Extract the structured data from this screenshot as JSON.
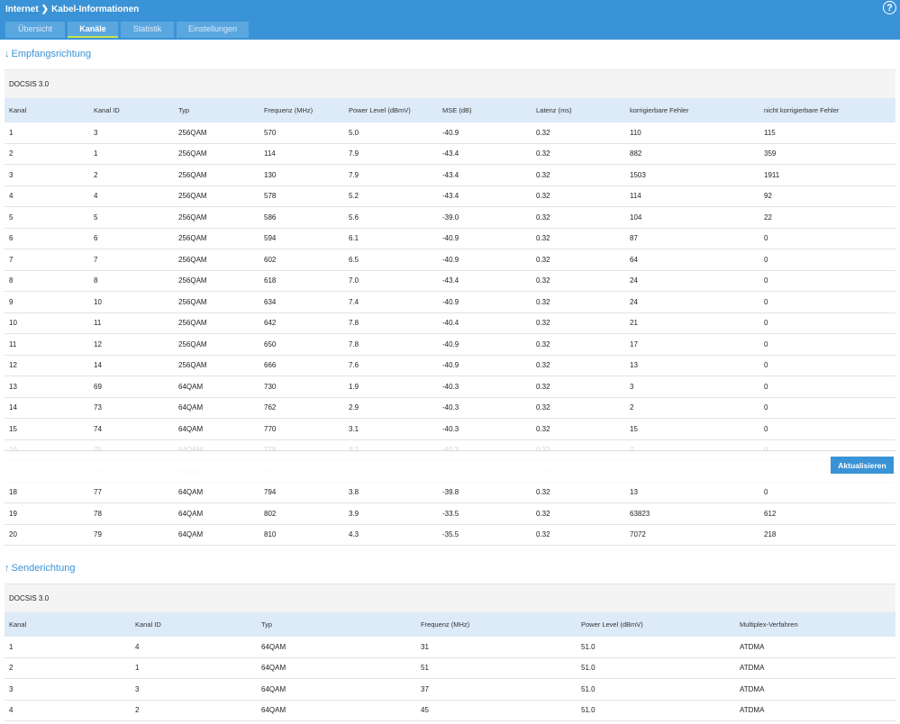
{
  "header": {
    "breadcrumb": [
      "Internet",
      "Kabel-Informationen"
    ],
    "help_glyph": "?"
  },
  "tabs": [
    {
      "label": "Übersicht",
      "active": false
    },
    {
      "label": "Kanäle",
      "active": true
    },
    {
      "label": "Statistik",
      "active": false
    },
    {
      "label": "Einstellungen",
      "active": false
    }
  ],
  "downstream": {
    "title": "Empfangsrichtung",
    "docsis": "DOCSIS 3.0",
    "columns": [
      "Kanal",
      "Kanal ID",
      "Typ",
      "Frequenz (MHz)",
      "Power Level (dBmV)",
      "MSE (dB)",
      "Latenz (ms)",
      "korrigierbare Fehler",
      "nicht korrigierbare Fehler"
    ],
    "rows": [
      [
        "1",
        "3",
        "256QAM",
        "570",
        "5.0",
        "-40.9",
        "0.32",
        "110",
        "115"
      ],
      [
        "2",
        "1",
        "256QAM",
        "114",
        "7.9",
        "-43.4",
        "0.32",
        "882",
        "359"
      ],
      [
        "3",
        "2",
        "256QAM",
        "130",
        "7.9",
        "-43.4",
        "0.32",
        "1503",
        "1911"
      ],
      [
        "4",
        "4",
        "256QAM",
        "578",
        "5.2",
        "-43.4",
        "0.32",
        "114",
        "92"
      ],
      [
        "5",
        "5",
        "256QAM",
        "586",
        "5.6",
        "-39.0",
        "0.32",
        "104",
        "22"
      ],
      [
        "6",
        "6",
        "256QAM",
        "594",
        "6.1",
        "-40.9",
        "0.32",
        "87",
        "0"
      ],
      [
        "7",
        "7",
        "256QAM",
        "602",
        "6.5",
        "-40.9",
        "0.32",
        "64",
        "0"
      ],
      [
        "8",
        "8",
        "256QAM",
        "618",
        "7.0",
        "-43.4",
        "0.32",
        "24",
        "0"
      ],
      [
        "9",
        "10",
        "256QAM",
        "634",
        "7.4",
        "-40.9",
        "0.32",
        "24",
        "0"
      ],
      [
        "10",
        "11",
        "256QAM",
        "642",
        "7.8",
        "-40.4",
        "0.32",
        "21",
        "0"
      ],
      [
        "11",
        "12",
        "256QAM",
        "650",
        "7.8",
        "-40.9",
        "0.32",
        "17",
        "0"
      ],
      [
        "12",
        "14",
        "256QAM",
        "666",
        "7.6",
        "-40.9",
        "0.32",
        "13",
        "0"
      ],
      [
        "13",
        "69",
        "64QAM",
        "730",
        "1.9",
        "-40.3",
        "0.32",
        "3",
        "0"
      ],
      [
        "14",
        "73",
        "64QAM",
        "762",
        "2.9",
        "-40.3",
        "0.32",
        "2",
        "0"
      ],
      [
        "15",
        "74",
        "64QAM",
        "770",
        "3.1",
        "-40.3",
        "0.32",
        "15",
        "0"
      ],
      [
        "16",
        "75",
        "64QAM",
        "778",
        "3.2",
        "-40.3",
        "0.32",
        "7",
        "0"
      ],
      [
        "17",
        "76",
        "64QAM",
        "786",
        "3.4",
        "-40.3",
        "0.32",
        "10",
        "0"
      ],
      [
        "18",
        "77",
        "64QAM",
        "794",
        "3.8",
        "-39.8",
        "0.32",
        "13",
        "0"
      ],
      [
        "19",
        "78",
        "64QAM",
        "802",
        "3.9",
        "-33.5",
        "0.32",
        "63823",
        "612"
      ],
      [
        "20",
        "79",
        "64QAM",
        "810",
        "4.3",
        "-35.5",
        "0.32",
        "7072",
        "218"
      ]
    ]
  },
  "upstream": {
    "title": "Senderichtung",
    "docsis": "DOCSIS 3.0",
    "columns": [
      "Kanal",
      "Kanal ID",
      "Typ",
      "Frequenz (MHz)",
      "Power Level (dBmV)",
      "Multiplex-Verfahren"
    ],
    "rows": [
      [
        "1",
        "4",
        "64QAM",
        "31",
        "51.0",
        "ATDMA"
      ],
      [
        "2",
        "1",
        "64QAM",
        "51",
        "51.0",
        "ATDMA"
      ],
      [
        "3",
        "3",
        "64QAM",
        "37",
        "51.0",
        "ATDMA"
      ],
      [
        "4",
        "2",
        "64QAM",
        "45",
        "51.0",
        "ATDMA"
      ]
    ]
  },
  "actions": {
    "refresh_label": "Aktualisieren"
  },
  "colors": {
    "brand_blue": "#3a93d6",
    "tab_blue": "#5aa7e0",
    "active_tab_underline": "#c9e04a",
    "table_header_bg": "#ddeaf7"
  }
}
